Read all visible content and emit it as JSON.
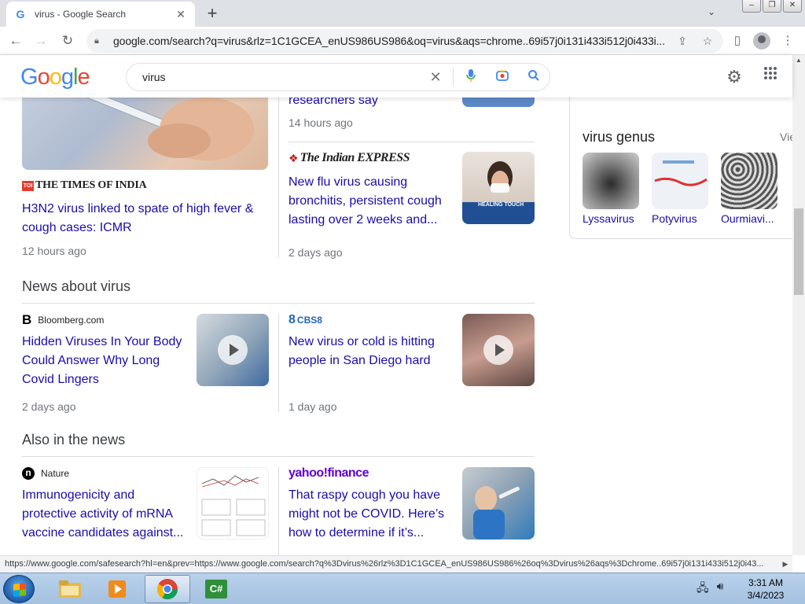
{
  "browser": {
    "tab_title": "virus - Google Search",
    "new_tab": "+",
    "url": "google.com/search?q=virus&rlz=1C1GCEA_enUS986US986&oq=virus&aqs=chrome..69i57j0i131i433i512j0i433i...",
    "status_url": "https://www.google.com/safesearch?hl=en&prev=https://www.google.com/search?q%3Dvirus%26rlz%3D1C1GCEA_enUS986US986%26oq%3Dvirus%26aqs%3Dchrome..69i57j0i131i433i512j0i43..."
  },
  "google": {
    "logo_letters": [
      "G",
      "o",
      "o",
      "g",
      "l",
      "e"
    ],
    "logo_colors": [
      "#4285f4",
      "#ea4335",
      "#fbbc05",
      "#4285f4",
      "#34a853",
      "#ea4335"
    ],
    "query": "virus"
  },
  "top_stories": {
    "left": {
      "source": "THE TIMES OF INDIA",
      "source_badge": "TOI",
      "headline": "H3N2 virus linked to spate of high fever & cough cases: ICMR",
      "age": "12 hours ago"
    },
    "right_top": {
      "headline_tail": "researchers say",
      "age": "14 hours ago"
    },
    "right": {
      "source": "The Indian EXPRESS",
      "headline": "New flu virus causing bronchitis, persistent cough lasting over 2 weeks and...",
      "age": "2 days ago",
      "thumb_caption": "HEALING TOUCH"
    }
  },
  "news_about": {
    "title": "News about virus",
    "items": [
      {
        "source_icon": "B",
        "source": "Bloomberg.com",
        "headline": "Hidden Viruses In Your Body Could Answer Why Long Covid Lingers",
        "age": "2 days ago"
      },
      {
        "source_icon": "8",
        "source": "CBS8",
        "headline": "New virus or cold is hitting people in San Diego hard",
        "age": "1 day ago"
      }
    ]
  },
  "also_news": {
    "title": "Also in the news",
    "items": [
      {
        "source_icon": "n",
        "source": "Nature",
        "headline": "Immunogenicity and protective activity of mRNA vaccine candidates against..."
      },
      {
        "source": "yahoo!finance",
        "headline": "That raspy cough you have might not be COVID. Here’s how to determine if it’s..."
      }
    ]
  },
  "knowledge_panel": {
    "title": "virus genus",
    "view_all": "Vie",
    "items": [
      "Lyssavirus",
      "Potyvirus",
      "Ourmiavi..."
    ]
  },
  "taskbar": {
    "time": "3:31 AM",
    "date": "3/4/2023",
    "csharp_label": "C#"
  }
}
